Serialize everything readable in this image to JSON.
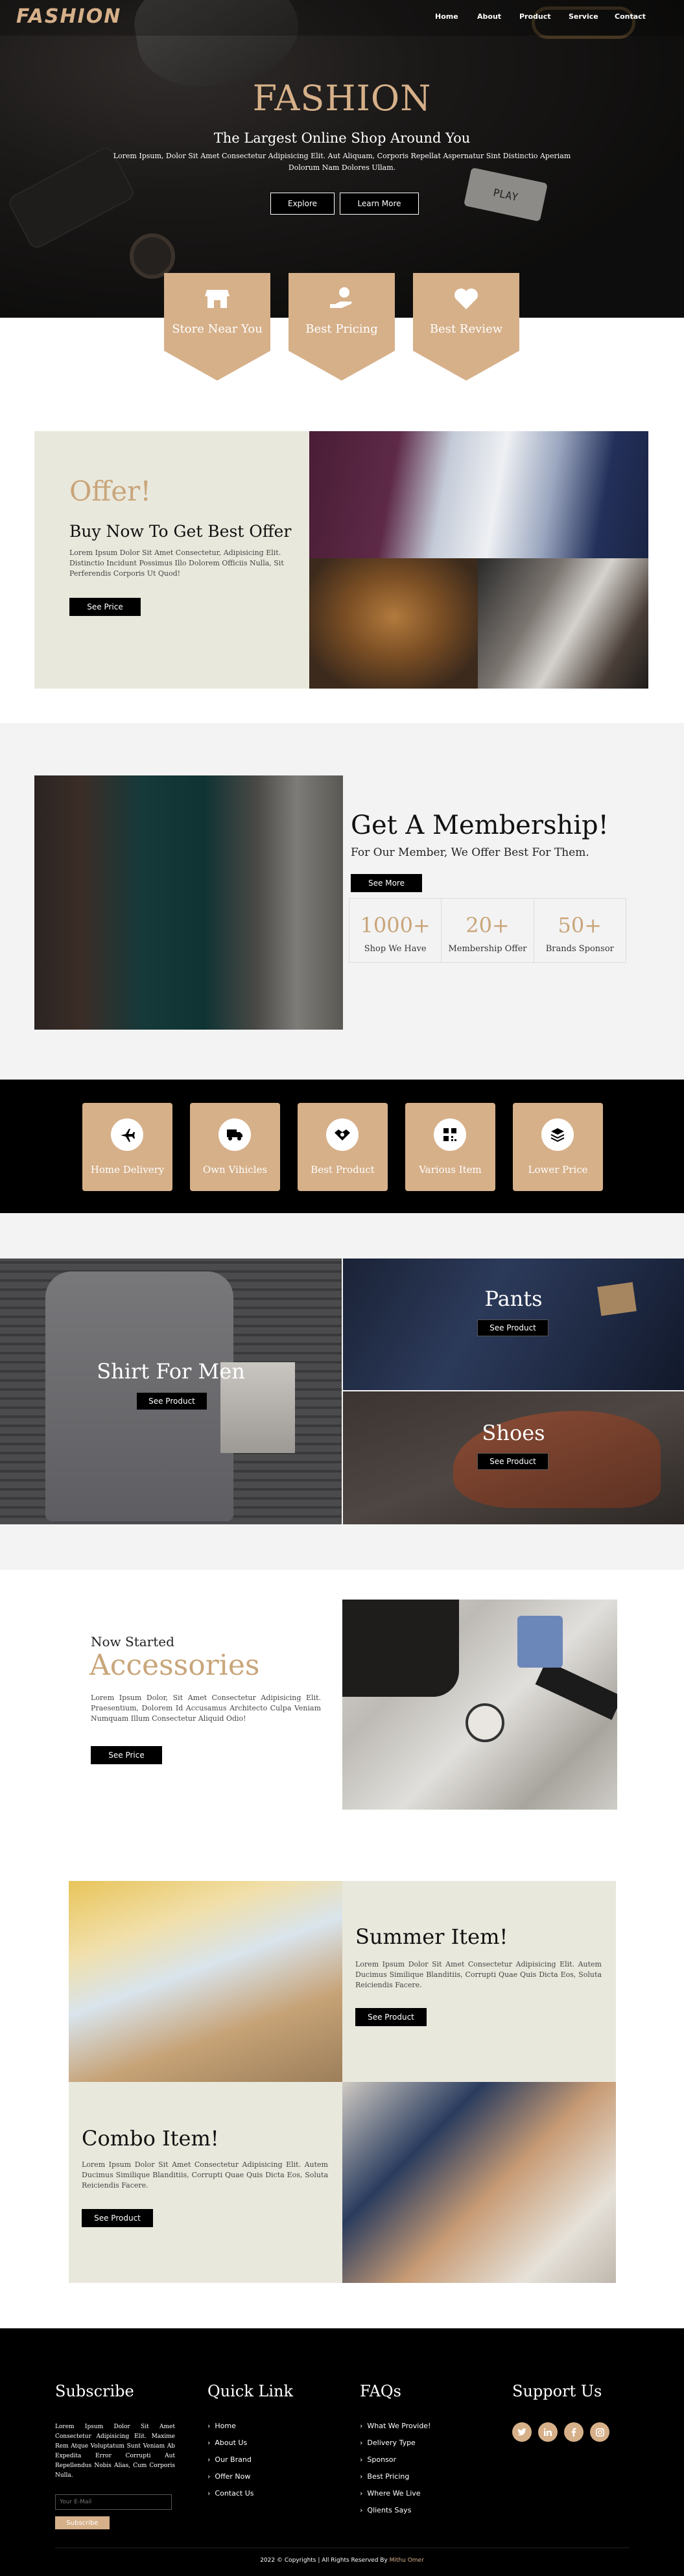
{
  "brand": {
    "logo": "FASHION",
    "accent": "#d6b089",
    "tan_text": "#c9a57a"
  },
  "nav": {
    "items": [
      "Home",
      "About",
      "Product",
      "Service",
      "Contact"
    ]
  },
  "hero": {
    "title": "FASHION",
    "subtitle": "The Largest Online Shop Around You",
    "body": "Lorem Ipsum, Dolor Sit Amet Consectetur Adipisicing Elit. Aut Aliquam, Corporis Repellat Aspernatur Sint Distinctio Aperiam Dolorum Nam Dolores Ullam.",
    "btn_explore": "Explore",
    "btn_learn": "Learn More"
  },
  "features": [
    {
      "label": "Store Near You",
      "icon": "store-icon"
    },
    {
      "label": "Best Pricing",
      "icon": "hand-dollar-icon"
    },
    {
      "label": "Best Review",
      "icon": "heart-icon"
    }
  ],
  "offer": {
    "kicker": "Offer!",
    "title": "Buy Now To Get Best Offer",
    "body": "Lorem Ipsum Dolor Sit Amet Consectetur, Adipisicing Elit. Distinctio Incidunt Possimus Illo Dolorem Officiis Nulla, Sit Perferendis Corporis Ut Quod!",
    "btn": "See Price"
  },
  "membership": {
    "title": "Get A Membership!",
    "subtitle": "For Our Member, We Offer Best For Them.",
    "btn": "See More",
    "stats": [
      {
        "value": "1000+",
        "label": "Shop We Have"
      },
      {
        "value": "20+",
        "label": "Membership Offer"
      },
      {
        "value": "50+",
        "label": "Brands Sponsor"
      }
    ]
  },
  "services": [
    {
      "label": "Home Delivery",
      "icon": "plane-icon"
    },
    {
      "label": "Own Vihicles",
      "icon": "truck-icon"
    },
    {
      "label": "Best Product",
      "icon": "handshake-icon"
    },
    {
      "label": "Various Item",
      "icon": "qrcode-icon"
    },
    {
      "label": "Lower Price",
      "icon": "layers-icon"
    }
  ],
  "categories": {
    "men": {
      "title": "Shirt For Men",
      "btn": "See Product"
    },
    "pants": {
      "title": "Pants",
      "btn": "See Product"
    },
    "shoes": {
      "title": "Shoes",
      "btn": "See Product"
    }
  },
  "accessories": {
    "kicker": "Now Started",
    "title": "Accessories",
    "body": "Lorem Ipsum Dolor, Sit Amet Consectetur Adipisicing Elit. Praesentium, Dolorem Id Accusamus Architecto Culpa Veniam Numquam Illum Consectetur Aliquid Odio!",
    "btn": "See Price"
  },
  "summer": {
    "title": "Summer Item!",
    "body": "Lorem Ipsum Dolor Sit Amet Consectetur Adipisicing Elit. Autem Ducimus Similique Blanditiis, Corrupti Quae Quis Dicta Eos, Soluta Reiciendis Facere.",
    "btn": "See Product"
  },
  "combo": {
    "title": "Combo Item!",
    "body": "Lorem Ipsum Dolor Sit Amet Consectetur Adipisicing Elit. Autem Ducimus Similique Blanditiis, Corrupti Quae Quis Dicta Eos, Soluta Reiciendis Facere.",
    "btn": "See Product"
  },
  "footer": {
    "subscribe": {
      "title": "Subscribe",
      "body": "Lorem Ipsum Dolor Sit Amet Consectetur Adipisicing Elit. Maxime Rem Atque Voluptatum Sunt Veniam Ab Expedita Error Corrupti Aut Repellendus Nobis Alias, Cum Corporis Nulla.",
      "placeholder": "Your E-Mail",
      "btn": "Subscribe"
    },
    "quick_link": {
      "title": "Quick Link",
      "items": [
        "Home",
        "About Us",
        "Our Brand",
        "Offer Now",
        "Contact Us"
      ]
    },
    "faqs": {
      "title": "FAQs",
      "items": [
        "What We Provide!",
        "Delivery Type",
        "Sponsor",
        "Best Pricing",
        "Where We Live",
        "Qlients Says"
      ]
    },
    "support": {
      "title": "Support Us",
      "socials": [
        "twitter-icon",
        "linkedin-icon",
        "facebook-icon",
        "instagram-icon"
      ]
    },
    "copyright_prefix": "2022 © Copyrights | All Rights Reserved By ",
    "copyright_name": "Mithu Omer"
  }
}
